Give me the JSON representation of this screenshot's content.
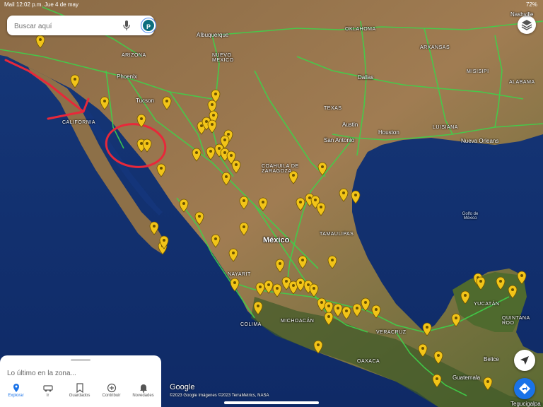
{
  "status_bar": {
    "left": "Mail  12:02 p.m.  Jue 4 de may",
    "right": "72%"
  },
  "search": {
    "placeholder": "Buscar aquí",
    "avatar_initial": "P"
  },
  "labels": {
    "states": {
      "arizona": "ARIZONA",
      "nuevo_mexico": "NUEVO\nMEXICO",
      "oklahoma": "OKLAHOMA",
      "arkansas": "ARKANSAS",
      "texas": "TEXAS",
      "misisipi": "MISISIPI",
      "alabama": "ALABAMA",
      "luisiana": "LUISIANA",
      "california": "CALIFORNIA",
      "coahuila": "COAHUILA DE\nZARAGOZA",
      "tamaulipas": "TAMAULIPAS",
      "nayarit": "NAYARIT",
      "colima": "COLIMA",
      "michoacan": "MICHOACÁN",
      "veracruz": "VERACRUZ",
      "oaxaca": "OAXACA",
      "yucatan": "YUCATÁN",
      "quintana_roo": "QUINTANA\nROO"
    },
    "cities": {
      "albuquerque": "Albuquerque",
      "tucson": "Tucson",
      "phoenix": "Phoenix",
      "dallas": "Dallas",
      "austin": "Austin",
      "san_antonio": "San Antonio",
      "houston": "Houston",
      "nueva_orleans": "Nueva Orleans",
      "nashville": "Nashville",
      "belice": "Belice",
      "guatemala": "Guatemala",
      "tegucigalpa": "Tegucigalpa"
    },
    "country": "México",
    "sea": "Golfo de\nMéxico"
  },
  "bottom_panel": {
    "recent": "Lo último en la zona..."
  },
  "nav": [
    {
      "label": "Explorar",
      "icon": "pin-icon",
      "active": true
    },
    {
      "label": "Ir",
      "icon": "car-icon",
      "active": false
    },
    {
      "label": "Guardados",
      "icon": "bookmark-icon",
      "active": false
    },
    {
      "label": "Contribuir",
      "icon": "plus-circle-icon",
      "active": false
    },
    {
      "label": "Novedades",
      "icon": "bell-icon",
      "active": false
    }
  ],
  "google_logo": "Google",
  "attribution": "©2023 Google  Imágenes ©2023 TerraMetrics, NASA",
  "colors": {
    "road": "#3fd14a",
    "pin": "#f2c418",
    "annotation": "#e8283a",
    "accent": "#1a73e8"
  }
}
